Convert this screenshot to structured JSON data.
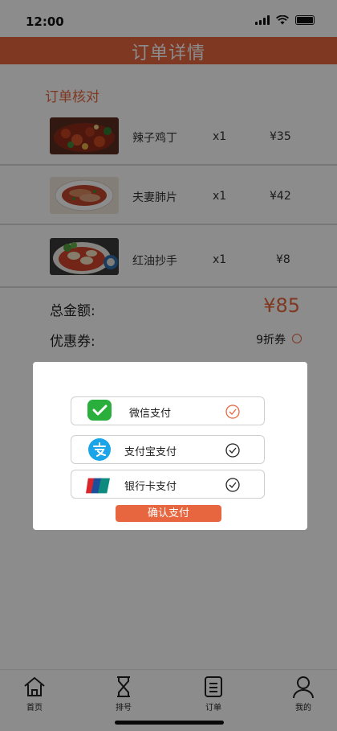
{
  "status_bar": {
    "time": "12:00"
  },
  "header": {
    "title": "订单详情"
  },
  "order": {
    "section_title": "订单核对",
    "items": [
      {
        "name": "辣子鸡丁",
        "qty": "x1",
        "price": "¥35"
      },
      {
        "name": "夫妻肺片",
        "qty": "x1",
        "price": "¥42"
      },
      {
        "name": "红油抄手",
        "qty": "x1",
        "price": "¥8"
      }
    ],
    "total_label": "总金额:",
    "total_value": "¥85",
    "coupon_label": "优惠券:",
    "coupon_value": "9折券"
  },
  "payment_modal": {
    "options": [
      {
        "label": "微信支付",
        "icon": "wechat-pay-icon",
        "selected": true
      },
      {
        "label": "支付宝支付",
        "icon": "alipay-icon",
        "selected": false
      },
      {
        "label": "银行卡支付",
        "icon": "unionpay-icon",
        "selected": false
      }
    ],
    "confirm_label": "确认支付"
  },
  "tabbar": {
    "items": [
      {
        "label": "首页",
        "icon": "home-icon",
        "active": true
      },
      {
        "label": "排号",
        "icon": "hourglass-icon",
        "active": false
      },
      {
        "label": "订单",
        "icon": "order-list-icon",
        "active": false
      },
      {
        "label": "我的",
        "icon": "user-icon",
        "active": false
      }
    ]
  },
  "colors": {
    "accent": "#e8663f",
    "wechat_green": "#2aae3c",
    "alipay_blue": "#1aa5e8"
  }
}
